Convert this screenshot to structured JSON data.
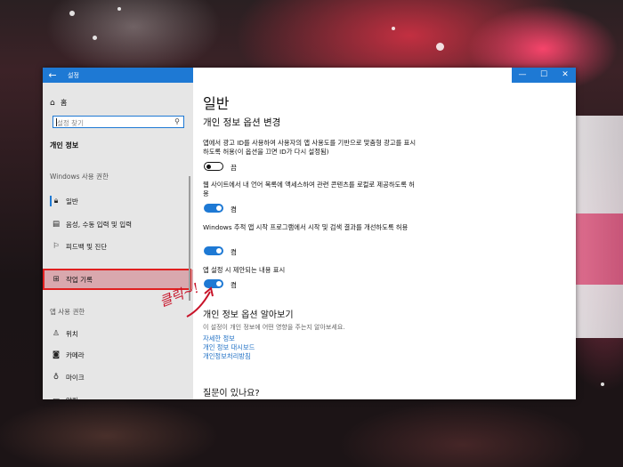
{
  "window": {
    "title": "설정",
    "back_icon": "back-arrow-icon",
    "controls": [
      "minimize-icon",
      "maximize-icon",
      "close-icon"
    ]
  },
  "sidebar": {
    "home_label": "홈",
    "search_placeholder": "설정 찾기",
    "section_title": "개인 정보",
    "group1_title": "Windows 사용 권한",
    "group1_items": [
      {
        "label": "일반",
        "icon": "lock-icon"
      },
      {
        "label": "음성, 수동 입력 및 입력",
        "icon": "speech-icon"
      },
      {
        "label": "피드백 및 진단",
        "icon": "feedback-icon"
      },
      {
        "label": "작업 기록",
        "icon": "activity-history-icon"
      }
    ],
    "group2_title": "앱 사용 권한",
    "group2_items": [
      {
        "label": "위치",
        "icon": "location-icon"
      },
      {
        "label": "카메라",
        "icon": "camera-icon"
      },
      {
        "label": "마이크",
        "icon": "microphone-icon"
      },
      {
        "label": "알림",
        "icon": "notification-icon"
      }
    ]
  },
  "main": {
    "title": "일반",
    "subtitle": "개인 정보 옵션 변경",
    "options": [
      {
        "desc": "앱에서 광고 ID를 사용하여 사용자의 앱 사용도를 기반으로 맞춤형 광고를 표시하도록 허용(이 옵션을 끄면 ID가 다시 설정됨)",
        "state": "끔",
        "on": false
      },
      {
        "desc": "웹 사이트에서 내 언어 목록에 액세스하여 관련 콘텐츠를 로컬로 제공하도록 허용",
        "state": "켬",
        "on": true
      },
      {
        "desc": "Windows 추적 앱 시작 프로그램에서 시작 및 검색 결과를 개선하도록 허용",
        "state": "켬",
        "on": true
      },
      {
        "desc": "앱 설정 시 제안되는 내용 표시",
        "state": "켬",
        "on": true
      }
    ],
    "learn_title": "개인 정보 옵션 알아보기",
    "learn_desc": "이 설정이 개인 정보에 어떤 영향을 주는지 알아보세요.",
    "links": [
      "자세한 정보",
      "개인 정보 대시보드",
      "개인정보처리방침"
    ],
    "question_title": "질문이 있나요?"
  },
  "annotation": {
    "text": "클릭~!",
    "color": "#c8142a"
  },
  "colors": {
    "accent": "#1e79d4",
    "highlight_box": "#e02020",
    "highlight_fill": "#d9a8ae"
  }
}
